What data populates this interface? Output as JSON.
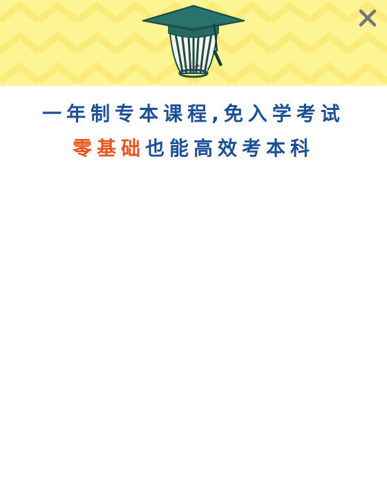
{
  "banner": {
    "background_color": "#fdf593",
    "icon": "graduation-cap-icon"
  },
  "close_button": {
    "icon": "close-icon",
    "symbol": "×"
  },
  "headline": {
    "line1": "一年制专本课程,免入学考试",
    "line2_highlight": "零基础",
    "line2_rest": "也能高效考本科",
    "color": "#1d4f94",
    "highlight_color": "#e8541e"
  }
}
